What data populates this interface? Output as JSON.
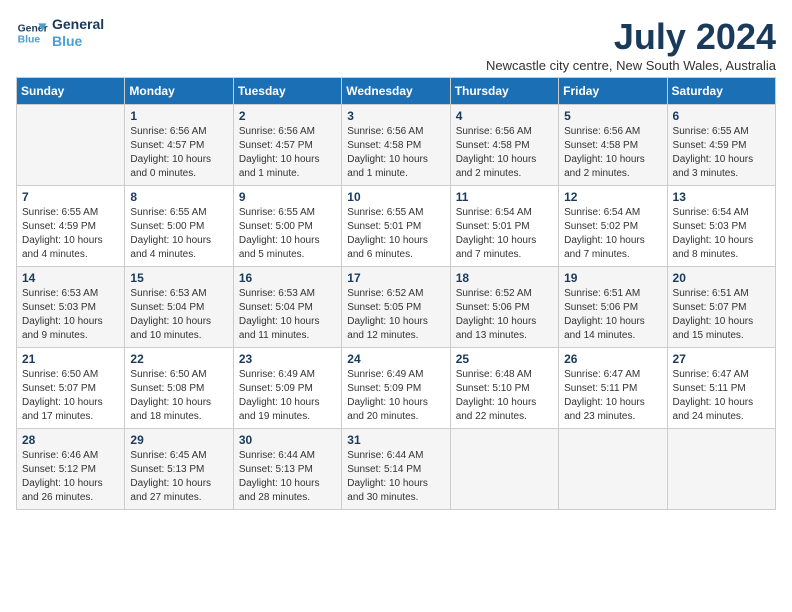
{
  "header": {
    "logo_line1": "General",
    "logo_line2": "Blue",
    "title": "July 2024",
    "location": "Newcastle city centre, New South Wales, Australia"
  },
  "columns": [
    "Sunday",
    "Monday",
    "Tuesday",
    "Wednesday",
    "Thursday",
    "Friday",
    "Saturday"
  ],
  "weeks": [
    [
      {
        "day": "",
        "info": ""
      },
      {
        "day": "1",
        "info": "Sunrise: 6:56 AM\nSunset: 4:57 PM\nDaylight: 10 hours\nand 0 minutes."
      },
      {
        "day": "2",
        "info": "Sunrise: 6:56 AM\nSunset: 4:57 PM\nDaylight: 10 hours\nand 1 minute."
      },
      {
        "day": "3",
        "info": "Sunrise: 6:56 AM\nSunset: 4:58 PM\nDaylight: 10 hours\nand 1 minute."
      },
      {
        "day": "4",
        "info": "Sunrise: 6:56 AM\nSunset: 4:58 PM\nDaylight: 10 hours\nand 2 minutes."
      },
      {
        "day": "5",
        "info": "Sunrise: 6:56 AM\nSunset: 4:58 PM\nDaylight: 10 hours\nand 2 minutes."
      },
      {
        "day": "6",
        "info": "Sunrise: 6:55 AM\nSunset: 4:59 PM\nDaylight: 10 hours\nand 3 minutes."
      }
    ],
    [
      {
        "day": "7",
        "info": "Sunrise: 6:55 AM\nSunset: 4:59 PM\nDaylight: 10 hours\nand 4 minutes."
      },
      {
        "day": "8",
        "info": "Sunrise: 6:55 AM\nSunset: 5:00 PM\nDaylight: 10 hours\nand 4 minutes."
      },
      {
        "day": "9",
        "info": "Sunrise: 6:55 AM\nSunset: 5:00 PM\nDaylight: 10 hours\nand 5 minutes."
      },
      {
        "day": "10",
        "info": "Sunrise: 6:55 AM\nSunset: 5:01 PM\nDaylight: 10 hours\nand 6 minutes."
      },
      {
        "day": "11",
        "info": "Sunrise: 6:54 AM\nSunset: 5:01 PM\nDaylight: 10 hours\nand 7 minutes."
      },
      {
        "day": "12",
        "info": "Sunrise: 6:54 AM\nSunset: 5:02 PM\nDaylight: 10 hours\nand 7 minutes."
      },
      {
        "day": "13",
        "info": "Sunrise: 6:54 AM\nSunset: 5:03 PM\nDaylight: 10 hours\nand 8 minutes."
      }
    ],
    [
      {
        "day": "14",
        "info": "Sunrise: 6:53 AM\nSunset: 5:03 PM\nDaylight: 10 hours\nand 9 minutes."
      },
      {
        "day": "15",
        "info": "Sunrise: 6:53 AM\nSunset: 5:04 PM\nDaylight: 10 hours\nand 10 minutes."
      },
      {
        "day": "16",
        "info": "Sunrise: 6:53 AM\nSunset: 5:04 PM\nDaylight: 10 hours\nand 11 minutes."
      },
      {
        "day": "17",
        "info": "Sunrise: 6:52 AM\nSunset: 5:05 PM\nDaylight: 10 hours\nand 12 minutes."
      },
      {
        "day": "18",
        "info": "Sunrise: 6:52 AM\nSunset: 5:06 PM\nDaylight: 10 hours\nand 13 minutes."
      },
      {
        "day": "19",
        "info": "Sunrise: 6:51 AM\nSunset: 5:06 PM\nDaylight: 10 hours\nand 14 minutes."
      },
      {
        "day": "20",
        "info": "Sunrise: 6:51 AM\nSunset: 5:07 PM\nDaylight: 10 hours\nand 15 minutes."
      }
    ],
    [
      {
        "day": "21",
        "info": "Sunrise: 6:50 AM\nSunset: 5:07 PM\nDaylight: 10 hours\nand 17 minutes."
      },
      {
        "day": "22",
        "info": "Sunrise: 6:50 AM\nSunset: 5:08 PM\nDaylight: 10 hours\nand 18 minutes."
      },
      {
        "day": "23",
        "info": "Sunrise: 6:49 AM\nSunset: 5:09 PM\nDaylight: 10 hours\nand 19 minutes."
      },
      {
        "day": "24",
        "info": "Sunrise: 6:49 AM\nSunset: 5:09 PM\nDaylight: 10 hours\nand 20 minutes."
      },
      {
        "day": "25",
        "info": "Sunrise: 6:48 AM\nSunset: 5:10 PM\nDaylight: 10 hours\nand 22 minutes."
      },
      {
        "day": "26",
        "info": "Sunrise: 6:47 AM\nSunset: 5:11 PM\nDaylight: 10 hours\nand 23 minutes."
      },
      {
        "day": "27",
        "info": "Sunrise: 6:47 AM\nSunset: 5:11 PM\nDaylight: 10 hours\nand 24 minutes."
      }
    ],
    [
      {
        "day": "28",
        "info": "Sunrise: 6:46 AM\nSunset: 5:12 PM\nDaylight: 10 hours\nand 26 minutes."
      },
      {
        "day": "29",
        "info": "Sunrise: 6:45 AM\nSunset: 5:13 PM\nDaylight: 10 hours\nand 27 minutes."
      },
      {
        "day": "30",
        "info": "Sunrise: 6:44 AM\nSunset: 5:13 PM\nDaylight: 10 hours\nand 28 minutes."
      },
      {
        "day": "31",
        "info": "Sunrise: 6:44 AM\nSunset: 5:14 PM\nDaylight: 10 hours\nand 30 minutes."
      },
      {
        "day": "",
        "info": ""
      },
      {
        "day": "",
        "info": ""
      },
      {
        "day": "",
        "info": ""
      }
    ]
  ]
}
